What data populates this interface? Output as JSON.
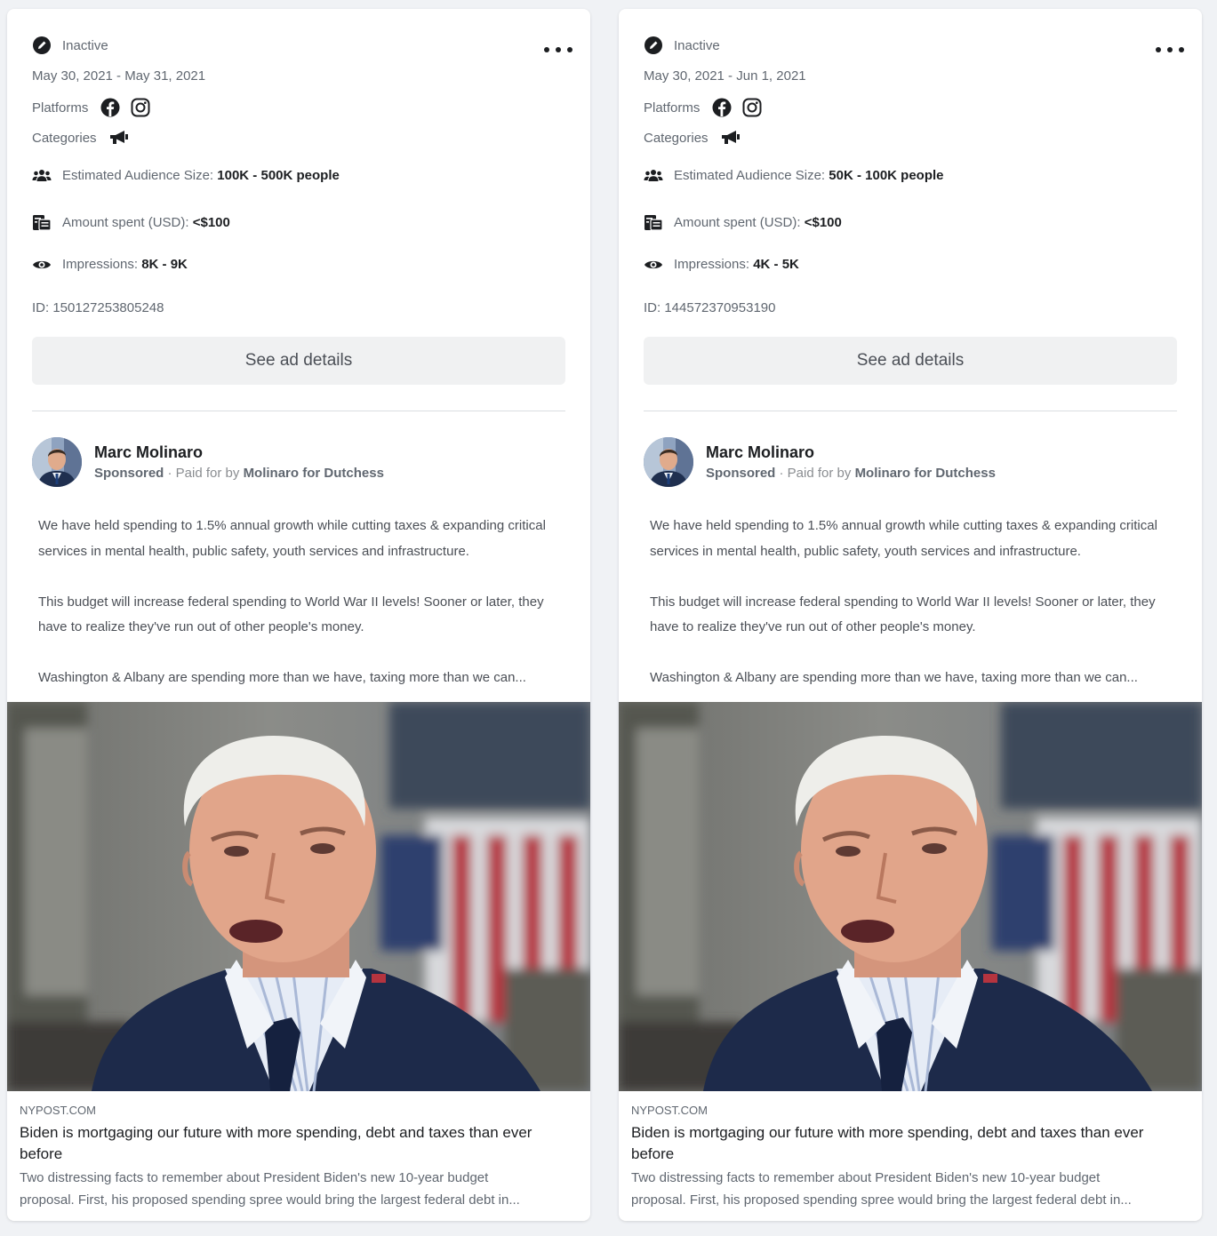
{
  "colors": {
    "page_bg": "#f0f2f5",
    "card_bg": "#ffffff",
    "muted_text": "#606770",
    "button_bg": "#f0f1f2"
  },
  "cards": [
    {
      "status": "Inactive",
      "dates": "May 30, 2021 - May 31, 2021",
      "platforms_label": "Platforms",
      "platforms": [
        "facebook-icon",
        "instagram-icon"
      ],
      "categories_label": "Categories",
      "category_icon": "megaphone-icon",
      "audience_label": "Estimated Audience Size:",
      "audience_value": "100K - 500K people",
      "spent_label": "Amount spent (USD):",
      "spent_value": "<$100",
      "impressions_label": "Impressions:",
      "impressions_value": "8K - 9K",
      "id_text": "ID: 150127253805248",
      "details_button": "See ad details",
      "advertiser": "Marc Molinaro",
      "sponsored": "Sponsored",
      "paid_for_by": "· Paid for by",
      "funder": "Molinaro for Dutchess",
      "body_p1": "We have held spending to 1.5% annual growth while cutting taxes & expanding critical services in mental health, public safety, youth services and infrastructure.",
      "body_p2": "This budget will increase federal spending to World War II levels! Sooner or later, they have to realize they've run out of other people's money.",
      "body_p3": "Washington & Albany are spending more than we have, taxing more than we can...",
      "link_domain": "NYPOST.COM",
      "link_title": "Biden is mortgaging our future with more spending, debt and taxes than ever before",
      "link_desc_1": "Two distressing facts to remember about President Biden's new 10-year budget",
      "link_desc_2": "proposal. First, his proposed spending spree would bring the largest federal debt in..."
    },
    {
      "status": "Inactive",
      "dates": "May 30, 2021 - Jun 1, 2021",
      "platforms_label": "Platforms",
      "platforms": [
        "facebook-icon",
        "instagram-icon"
      ],
      "categories_label": "Categories",
      "category_icon": "megaphone-icon",
      "audience_label": "Estimated Audience Size:",
      "audience_value": "50K - 100K people",
      "spent_label": "Amount spent (USD):",
      "spent_value": "<$100",
      "impressions_label": "Impressions:",
      "impressions_value": "4K - 5K",
      "id_text": "ID: 144572370953190",
      "details_button": "See ad details",
      "advertiser": "Marc Molinaro",
      "sponsored": "Sponsored",
      "paid_for_by": "· Paid for by",
      "funder": "Molinaro for Dutchess",
      "body_p1": "We have held spending to 1.5% annual growth while cutting taxes & expanding critical services in mental health, public safety, youth services and infrastructure.",
      "body_p2": "This budget will increase federal spending to World War II levels! Sooner or later, they have to realize they've run out of other people's money.",
      "body_p3": "Washington & Albany are spending more than we have, taxing more than we can...",
      "link_domain": "NYPOST.COM",
      "link_title": "Biden is mortgaging our future with more spending, debt and taxes than ever before",
      "link_desc_1": "Two distressing facts to remember about President Biden's new 10-year budget",
      "link_desc_2": "proposal. First, his proposed spending spree would bring the largest federal debt in..."
    }
  ]
}
